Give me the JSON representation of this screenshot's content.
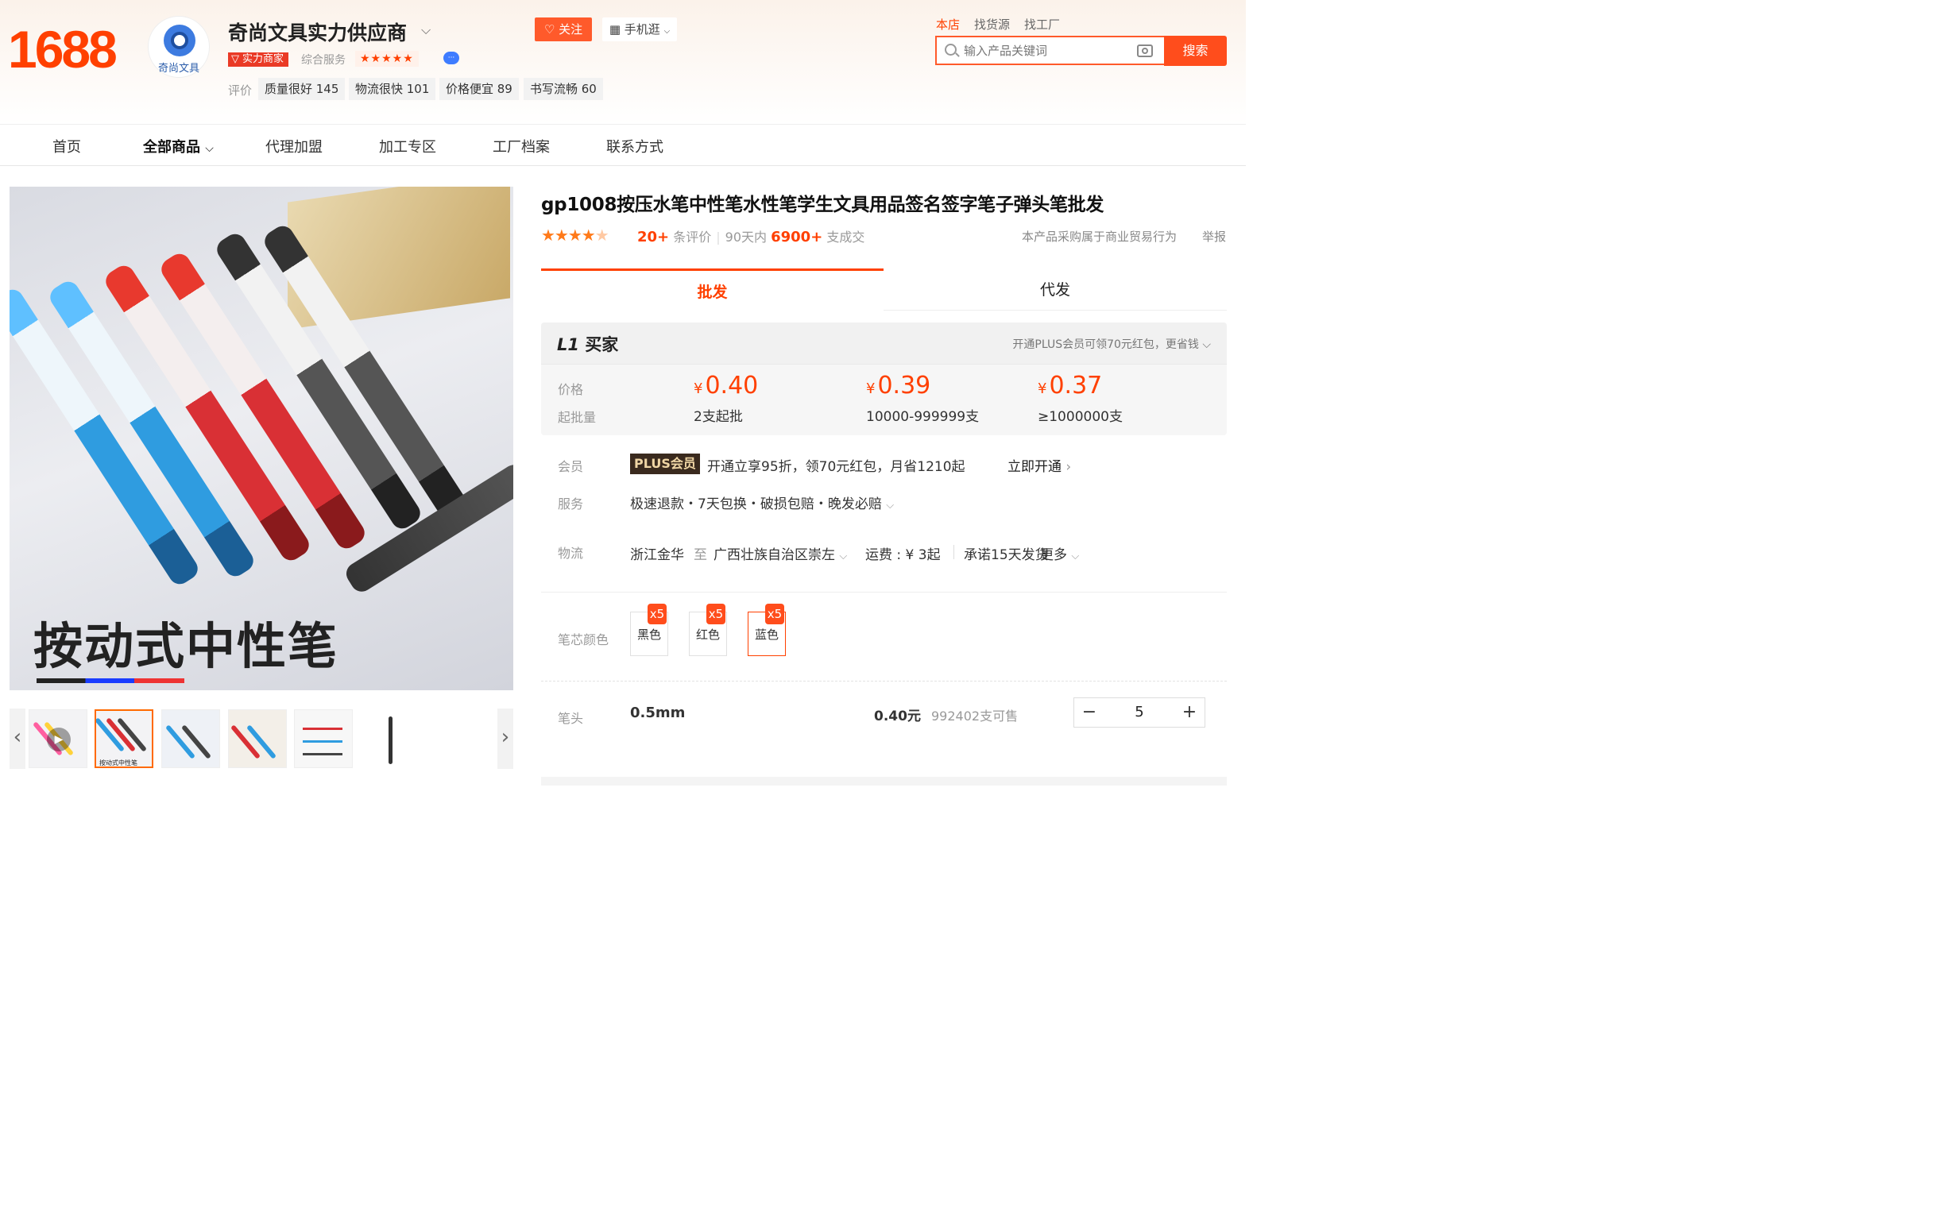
{
  "header": {
    "logo": "1688",
    "shop_avatar_text": "奇尚文具",
    "shop_name": "奇尚文具实力供应商",
    "badge_power": "实力商家",
    "service_label": "综合服务",
    "service_stars": "★★★★★",
    "follow_label": "关注",
    "mobile_label": "手机逛",
    "reviews_label": "评价",
    "review_tags": [
      "质量很好 145",
      "物流很快 101",
      "价格便宜 89",
      "书写流畅 60"
    ],
    "search_scope": [
      "本店",
      "找货源",
      "找工厂"
    ],
    "search_placeholder": "输入产品关键词",
    "search_button": "搜索"
  },
  "nav": {
    "items": [
      "首页",
      "全部商品",
      "代理加盟",
      "加工专区",
      "工厂档案",
      "联系方式"
    ],
    "active": "全部商品"
  },
  "gallery": {
    "main_caption": "按动式中性笔",
    "thumb_captions": [
      "按动式中性笔"
    ]
  },
  "product": {
    "title": "gp1008按压水笔中性笔水性笔学生文具用品签名签字笔子弹头笔批发",
    "rating_stars": 4.5,
    "review_count": "20+",
    "review_label": "条评价",
    "period_label": "90天内",
    "sales": "6900+",
    "sales_label": "支成交",
    "biz_note": "本产品采购属于商业贸易行为",
    "report": "举报"
  },
  "tabs": [
    "批发",
    "代发"
  ],
  "pricing": {
    "level": "L1",
    "level_label": "买家",
    "plus_promo": "开通PLUS会员可领70元红包，更省钱",
    "price_label": "价格",
    "moq_label": "起批量",
    "currency": "¥",
    "tiers": [
      {
        "price": "0.40",
        "qty": "2支起批"
      },
      {
        "price": "0.39",
        "qty": "10000-999999支"
      },
      {
        "price": "0.37",
        "qty": "≥1000000支"
      }
    ]
  },
  "member": {
    "label": "会员",
    "badge": "PLUS会员",
    "text": "开通立享95折，领70元红包，月省1210起",
    "action": "立即开通"
  },
  "service": {
    "label": "服务",
    "text": "极速退款・7天包换・破损包赔・晚发必赔"
  },
  "logistics": {
    "label": "物流",
    "from": "浙江金华",
    "to_word": "至",
    "to": "广西壮族自治区崇左",
    "fee": "运费 : ¥ 3起",
    "promise": "承诺15天发货",
    "more": "更多"
  },
  "sku": {
    "label": "笔芯颜色",
    "options": [
      {
        "name": "黑色",
        "count": "x5"
      },
      {
        "name": "红色",
        "count": "x5"
      },
      {
        "name": "蓝色",
        "count": "x5"
      }
    ],
    "selected": "蓝色"
  },
  "tip": {
    "label": "笔头",
    "size": "0.5mm",
    "price": "0.40元",
    "stock": "992402支可售",
    "quantity": "5",
    "minus": "−",
    "plus": "+"
  }
}
